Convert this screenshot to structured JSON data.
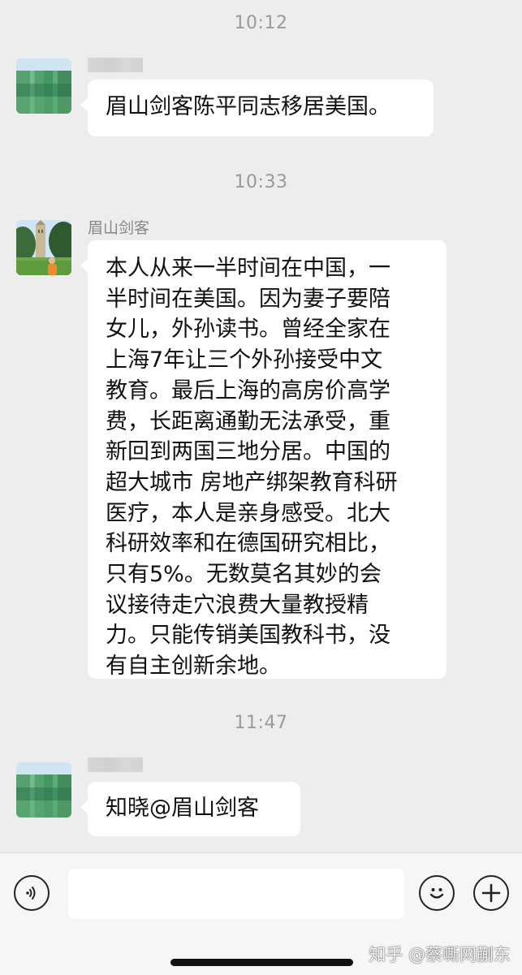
{
  "chat": {
    "timestamps": [
      "10:12",
      "10:33",
      "11:47"
    ],
    "messages": [
      {
        "sender": "",
        "lines": [
          "眉山剑客陈平同志移居美国。"
        ]
      },
      {
        "sender": "眉山剑客",
        "lines": [
          "本人从来一半时间在中国，一",
          "半时间在美国。因为妻子要陪",
          "女儿，外孙读书。曾经全家在",
          "上海7年让三个外孙接受中文",
          "教育。最后上海的高房价高学",
          "费，长距离通勤无法承受，重",
          "新回到两国三地分居。中国的",
          "超大城市 房地产绑架教育科研",
          "医疗，本人是亲身感受。北大",
          "科研效率和在德国研究相比，",
          "只有5%。无数莫名其妙的会",
          "议接待走穴浪费大量教授精",
          "力。只能传销美国教科书，没",
          "有自主创新余地。"
        ]
      },
      {
        "sender": "",
        "lines": [
          "知晓@眉山剑客"
        ]
      }
    ]
  },
  "input_bar": {
    "icons": [
      "voice-icon",
      "emoji-icon",
      "plus-icon"
    ],
    "text_value": ""
  },
  "watermark": "知乎 @蔡嘶网蒯东",
  "colors": {
    "background": "#ededed",
    "bubble": "#ffffff",
    "timestamp": "#9a9a9a",
    "sender_name": "#888888"
  }
}
